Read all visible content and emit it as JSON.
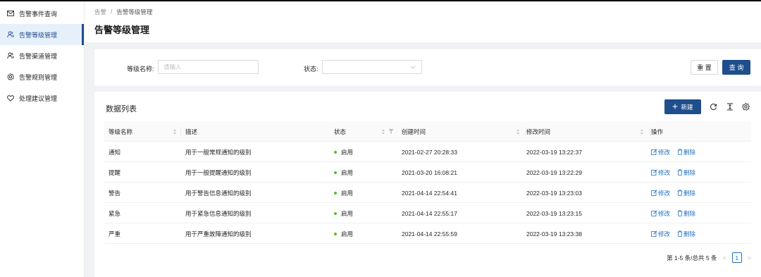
{
  "colors": {
    "primary": "#1f4e8c",
    "link": "#1f6fc5",
    "status_on": "#52c41a"
  },
  "sidebar": {
    "items": [
      {
        "label": "告警事件查询",
        "icon": "mail-icon",
        "active": false
      },
      {
        "label": "告警等级管理",
        "icon": "users-icon",
        "active": true
      },
      {
        "label": "告警渠道管理",
        "icon": "users-icon",
        "active": false
      },
      {
        "label": "告警规则管理",
        "icon": "gear-icon",
        "active": false
      },
      {
        "label": "处理建议管理",
        "icon": "heart-icon",
        "active": false
      }
    ]
  },
  "header": {
    "breadcrumb": [
      "告警",
      "/",
      "告警等级管理"
    ],
    "title": "告警等级管理"
  },
  "filter": {
    "level_label": "等级名称:",
    "level_placeholder": "请输入",
    "status_label": "状态:",
    "status_value": "",
    "reset_label": "重 置",
    "query_label": "查 询"
  },
  "table": {
    "title": "数据列表",
    "new_label": "新建",
    "columns": [
      "等级名称",
      "描述",
      "状态",
      "创建时间",
      "修改时间",
      "操作"
    ],
    "rows": [
      {
        "name": "通知",
        "desc": "用于一般常规通知的级别",
        "status": "启用",
        "created": "2021-02-27 20:28:33",
        "modified": "2022-03-19 13:22:37",
        "edit": "修改",
        "delete": "删除"
      },
      {
        "name": "提醒",
        "desc": "用于一般提醒通知的级别",
        "status": "启用",
        "created": "2021-03-20 16:08:21",
        "modified": "2022-03-19 13:22:29",
        "edit": "修改",
        "delete": "删除"
      },
      {
        "name": "警告",
        "desc": "用于警告信息通知的级别",
        "status": "启用",
        "created": "2021-04-14 22:54:41",
        "modified": "2022-03-19 13:23:03",
        "edit": "修改",
        "delete": "删除"
      },
      {
        "name": "紧急",
        "desc": "用于紧急信息通知的级别",
        "status": "启用",
        "created": "2021-04-14 22:55:17",
        "modified": "2022-03-19 13:23:15",
        "edit": "修改",
        "delete": "删除"
      },
      {
        "name": "严重",
        "desc": "用于严重故障通知的级别",
        "status": "启用",
        "created": "2021-04-14 22:55:59",
        "modified": "2022-03-19 13:23:38",
        "edit": "修改",
        "delete": "删除"
      }
    ]
  },
  "pagination": {
    "summary": "第 1-5 条/总共 5 条",
    "current_page": "1",
    "prev": "<",
    "next": ">"
  }
}
